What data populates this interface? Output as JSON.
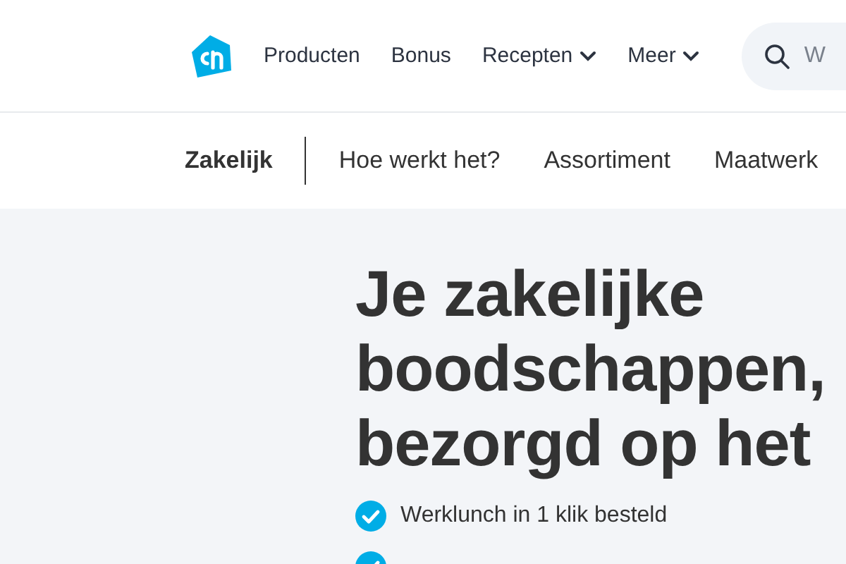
{
  "header": {
    "nav": [
      {
        "label": "Producten",
        "dropdown": false
      },
      {
        "label": "Bonus",
        "dropdown": false
      },
      {
        "label": "Recepten",
        "dropdown": true
      },
      {
        "label": "Meer",
        "dropdown": true
      }
    ],
    "search": {
      "placeholder": "W"
    }
  },
  "subnav": {
    "title": "Zakelijk",
    "items": [
      "Hoe werkt het?",
      "Assortiment",
      "Maatwerk"
    ]
  },
  "hero": {
    "heading_lines": [
      "Je zakelijke",
      "boodschappen,",
      "bezorgd op het"
    ],
    "benefits": [
      "Werklunch in 1 klik besteld"
    ]
  }
}
